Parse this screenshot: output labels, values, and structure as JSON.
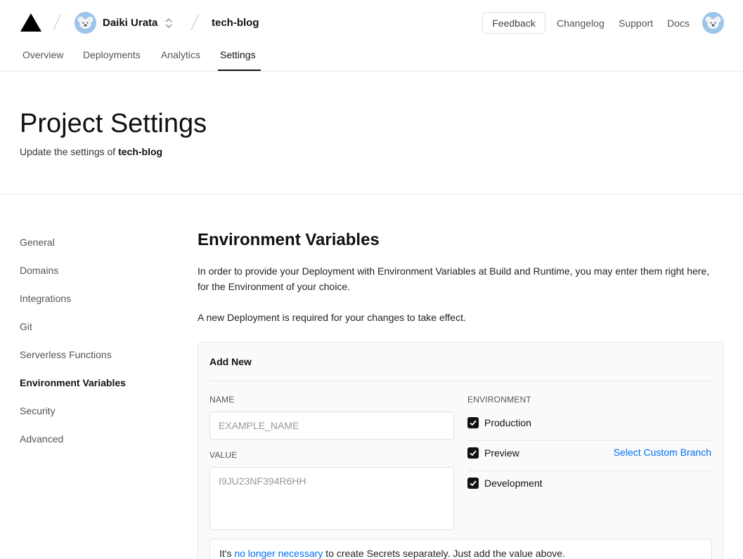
{
  "header": {
    "team_name": "Daiki Urata",
    "project_name": "tech-blog",
    "feedback_label": "Feedback",
    "links": [
      "Changelog",
      "Support",
      "Docs"
    ]
  },
  "tabs": [
    "Overview",
    "Deployments",
    "Analytics",
    "Settings"
  ],
  "active_tab": "Settings",
  "page": {
    "title": "Project Settings",
    "subtitle_prefix": "Update the settings of ",
    "subtitle_project": "tech-blog"
  },
  "sidebar": {
    "items": [
      "General",
      "Domains",
      "Integrations",
      "Git",
      "Serverless Functions",
      "Environment Variables",
      "Security",
      "Advanced"
    ],
    "active": "Environment Variables"
  },
  "section": {
    "title": "Environment Variables",
    "description": "In order to provide your Deployment with Environment Variables at Build and Runtime, you may enter them right here, for the Environment of your choice.",
    "notice": "A new Deployment is required for your changes to take effect."
  },
  "form": {
    "card_title": "Add New",
    "name_label": "NAME",
    "name_placeholder": "EXAMPLE_NAME",
    "value_label": "VALUE",
    "value_placeholder": "I9JU23NF394R6HH",
    "environment_label": "ENVIRONMENT",
    "environments": [
      {
        "label": "Production",
        "checked": true
      },
      {
        "label": "Preview",
        "checked": true
      },
      {
        "label": "Development",
        "checked": true
      }
    ],
    "custom_branch_label": "Select Custom Branch",
    "note_prefix": "It's ",
    "note_link": "no longer necessary",
    "note_suffix": " to create Secrets separately. Just add the value above."
  },
  "colors": {
    "accent": "#0070f3",
    "avatar": "#9cc5ea",
    "text": "#111111"
  }
}
